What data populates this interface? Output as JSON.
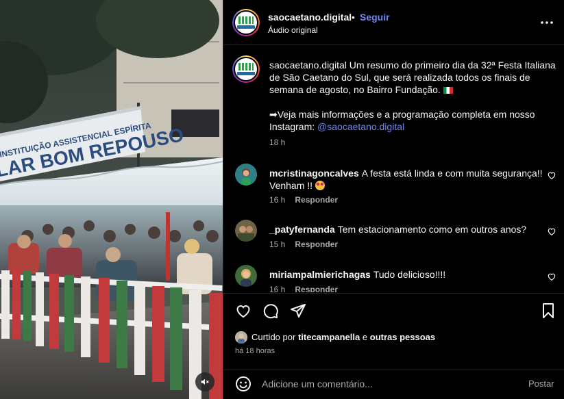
{
  "post": {
    "username": "saocaetano.digital",
    "dot": "•",
    "follow_label": "Seguir",
    "audio_label": "Áudio original",
    "more_icon": "more-horizontal-icon"
  },
  "media": {
    "sign_line1": "INSTITUIÇÃO ASSISTENCIAL ESPÍRITA",
    "sign_line2": "LAR BOM REPOUSO",
    "mute_icon": "volume-off-icon"
  },
  "caption": {
    "username": "saocaetano.digital",
    "text1": "Um resumo do primeiro dia da 32ª Festa Italiana de São Caetano do Sul, que será realizada todos os finais de semana de agosto, no Bairro Fundação.",
    "flag_icon": "italy-flag-icon",
    "text2": "➡Veja mais informações e a programação completa em nosso Instagram:",
    "mention": "@saocaetano.digital",
    "time": "18 h"
  },
  "comments": [
    {
      "username": "mcristinagoncalves",
      "text": "A festa está linda e com muita segurança!! Venham !!",
      "time": "16 h",
      "reply": "Responder"
    },
    {
      "username": "_patyfernanda",
      "text": "Tem estacionamento como em outros anos?",
      "time": "15 h",
      "reply": "Responder"
    },
    {
      "username": "miriampalmierichagas",
      "text": "Tudo delicioso!!!!",
      "time": "16 h",
      "reply": "Responder"
    }
  ],
  "actions": {
    "like_icon": "heart-icon",
    "comment_icon": "comment-icon",
    "share_icon": "send-icon",
    "save_icon": "bookmark-icon"
  },
  "likes": {
    "prefix": "Curtido por",
    "user": "titecampanella",
    "conj": "e",
    "others": "outras pessoas"
  },
  "posted_ago": "há 18 horas",
  "add_comment": {
    "placeholder": "Adicione um comentário...",
    "post_label": "Postar"
  },
  "colors": {
    "background": "#000000",
    "link": "#6f86f5",
    "muted": "#a8a8a8",
    "divider": "#262626"
  }
}
